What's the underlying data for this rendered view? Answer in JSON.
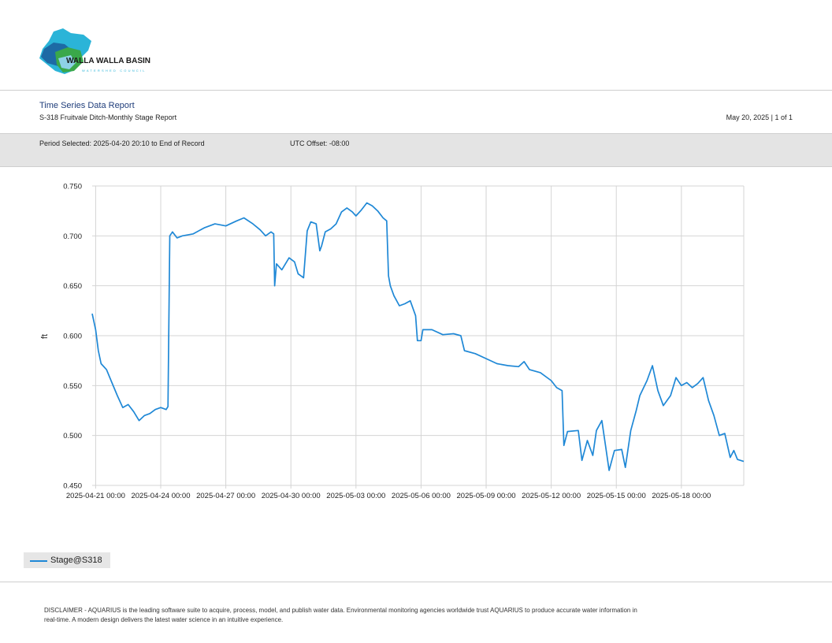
{
  "logo": {
    "title": "WALLA WALLA BASIN",
    "subtitle": "WATERSHED COUNCIL"
  },
  "header": {
    "title": "Time Series Data Report",
    "subtitle": "S-318 Fruitvale Ditch-Monthly Stage Report",
    "date_page": "May 20, 2025 | 1 of 1"
  },
  "period": {
    "selected": "Period Selected: 2025-04-20 20:10 to End of Record",
    "utc": "UTC Offset: -08:00"
  },
  "chart_data": {
    "type": "line",
    "ylabel": "ft",
    "ylim": [
      0.45,
      0.75
    ],
    "yticks": [
      "0.450",
      "0.500",
      "0.550",
      "0.600",
      "0.650",
      "0.700",
      "0.750"
    ],
    "xlim": [
      "2025-04-20 20:10",
      "2025-05-20 21:00"
    ],
    "xticks": [
      "2025-04-21 00:00",
      "2025-04-24 00:00",
      "2025-04-27 00:00",
      "2025-04-30 00:00",
      "2025-05-03 00:00",
      "2025-05-06 00:00",
      "2025-05-09 00:00",
      "2025-05-12 00:00",
      "2025-05-15 00:00",
      "2025-05-18 00:00"
    ],
    "grid": true,
    "legend_position": "bottom-left",
    "series": [
      {
        "name": "Stage@S318",
        "color": "#1f88d6",
        "points": [
          [
            "2025-04-20 20:10",
            0.622
          ],
          [
            "2025-04-21 00:00",
            0.606
          ],
          [
            "2025-04-21 03:00",
            0.585
          ],
          [
            "2025-04-21 06:00",
            0.572
          ],
          [
            "2025-04-21 12:00",
            0.566
          ],
          [
            "2025-04-21 18:00",
            0.553
          ],
          [
            "2025-04-22 00:00",
            0.54
          ],
          [
            "2025-04-22 06:00",
            0.528
          ],
          [
            "2025-04-22 12:00",
            0.531
          ],
          [
            "2025-04-22 18:00",
            0.524
          ],
          [
            "2025-04-23 00:00",
            0.515
          ],
          [
            "2025-04-23 06:00",
            0.52
          ],
          [
            "2025-04-23 12:00",
            0.522
          ],
          [
            "2025-04-23 18:00",
            0.526
          ],
          [
            "2025-04-24 00:00",
            0.528
          ],
          [
            "2025-04-24 06:00",
            0.526
          ],
          [
            "2025-04-24 08:00",
            0.529
          ],
          [
            "2025-04-24 10:00",
            0.7
          ],
          [
            "2025-04-24 13:00",
            0.704
          ],
          [
            "2025-04-24 18:00",
            0.698
          ],
          [
            "2025-04-25 00:00",
            0.7
          ],
          [
            "2025-04-25 12:00",
            0.702
          ],
          [
            "2025-04-26 00:00",
            0.708
          ],
          [
            "2025-04-26 12:00",
            0.712
          ],
          [
            "2025-04-27 00:00",
            0.71
          ],
          [
            "2025-04-27 12:00",
            0.715
          ],
          [
            "2025-04-27 20:00",
            0.718
          ],
          [
            "2025-04-28 06:00",
            0.712
          ],
          [
            "2025-04-28 14:00",
            0.706
          ],
          [
            "2025-04-28 20:00",
            0.7
          ],
          [
            "2025-04-29 02:00",
            0.704
          ],
          [
            "2025-04-29 05:00",
            0.702
          ],
          [
            "2025-04-29 06:00",
            0.65
          ],
          [
            "2025-04-29 08:00",
            0.672
          ],
          [
            "2025-04-29 14:00",
            0.666
          ],
          [
            "2025-04-29 18:00",
            0.672
          ],
          [
            "2025-04-29 22:00",
            0.678
          ],
          [
            "2025-04-30 04:00",
            0.674
          ],
          [
            "2025-04-30 08:00",
            0.662
          ],
          [
            "2025-04-30 14:00",
            0.658
          ],
          [
            "2025-04-30 18:00",
            0.705
          ],
          [
            "2025-04-30 22:00",
            0.714
          ],
          [
            "2025-05-01 04:00",
            0.712
          ],
          [
            "2025-05-01 08:00",
            0.685
          ],
          [
            "2025-05-01 10:00",
            0.69
          ],
          [
            "2025-05-01 14:00",
            0.704
          ],
          [
            "2025-05-01 20:00",
            0.707
          ],
          [
            "2025-05-02 02:00",
            0.712
          ],
          [
            "2025-05-02 08:00",
            0.724
          ],
          [
            "2025-05-02 14:00",
            0.728
          ],
          [
            "2025-05-02 20:00",
            0.724
          ],
          [
            "2025-05-03 00:00",
            0.72
          ],
          [
            "2025-05-03 06:00",
            0.726
          ],
          [
            "2025-05-03 12:00",
            0.733
          ],
          [
            "2025-05-03 18:00",
            0.73
          ],
          [
            "2025-05-04 00:00",
            0.725
          ],
          [
            "2025-05-04 06:00",
            0.718
          ],
          [
            "2025-05-04 10:00",
            0.715
          ],
          [
            "2025-05-04 12:00",
            0.66
          ],
          [
            "2025-05-04 14:00",
            0.65
          ],
          [
            "2025-05-04 18:00",
            0.64
          ],
          [
            "2025-05-05 00:00",
            0.63
          ],
          [
            "2025-05-05 06:00",
            0.632
          ],
          [
            "2025-05-05 12:00",
            0.635
          ],
          [
            "2025-05-05 18:00",
            0.62
          ],
          [
            "2025-05-05 20:00",
            0.595
          ],
          [
            "2025-05-06 00:00",
            0.595
          ],
          [
            "2025-05-06 02:00",
            0.606
          ],
          [
            "2025-05-06 12:00",
            0.606
          ],
          [
            "2025-05-07 00:00",
            0.601
          ],
          [
            "2025-05-07 12:00",
            0.602
          ],
          [
            "2025-05-07 20:00",
            0.6
          ],
          [
            "2025-05-08 00:00",
            0.585
          ],
          [
            "2025-05-08 12:00",
            0.582
          ],
          [
            "2025-05-09 00:00",
            0.577
          ],
          [
            "2025-05-09 12:00",
            0.572
          ],
          [
            "2025-05-10 00:00",
            0.57
          ],
          [
            "2025-05-10 12:00",
            0.569
          ],
          [
            "2025-05-10 18:00",
            0.574
          ],
          [
            "2025-05-11 00:00",
            0.566
          ],
          [
            "2025-05-11 12:00",
            0.563
          ],
          [
            "2025-05-12 00:00",
            0.555
          ],
          [
            "2025-05-12 06:00",
            0.548
          ],
          [
            "2025-05-12 12:00",
            0.545
          ],
          [
            "2025-05-12 14:00",
            0.49
          ],
          [
            "2025-05-12 18:00",
            0.504
          ],
          [
            "2025-05-13 06:00",
            0.505
          ],
          [
            "2025-05-13 10:00",
            0.475
          ],
          [
            "2025-05-13 16:00",
            0.495
          ],
          [
            "2025-05-13 22:00",
            0.48
          ],
          [
            "2025-05-14 02:00",
            0.505
          ],
          [
            "2025-05-14 08:00",
            0.515
          ],
          [
            "2025-05-14 12:00",
            0.49
          ],
          [
            "2025-05-14 16:00",
            0.465
          ],
          [
            "2025-05-14 22:00",
            0.485
          ],
          [
            "2025-05-15 06:00",
            0.486
          ],
          [
            "2025-05-15 10:00",
            0.468
          ],
          [
            "2025-05-15 16:00",
            0.505
          ],
          [
            "2025-05-15 22:00",
            0.525
          ],
          [
            "2025-05-16 02:00",
            0.54
          ],
          [
            "2025-05-16 10:00",
            0.555
          ],
          [
            "2025-05-16 16:00",
            0.57
          ],
          [
            "2025-05-16 22:00",
            0.545
          ],
          [
            "2025-05-17 04:00",
            0.53
          ],
          [
            "2025-05-17 12:00",
            0.54
          ],
          [
            "2025-05-17 18:00",
            0.558
          ],
          [
            "2025-05-18 00:00",
            0.55
          ],
          [
            "2025-05-18 06:00",
            0.553
          ],
          [
            "2025-05-18 12:00",
            0.548
          ],
          [
            "2025-05-18 18:00",
            0.552
          ],
          [
            "2025-05-19 00:00",
            0.558
          ],
          [
            "2025-05-19 06:00",
            0.535
          ],
          [
            "2025-05-19 12:00",
            0.52
          ],
          [
            "2025-05-19 18:00",
            0.5
          ],
          [
            "2025-05-20 00:00",
            0.502
          ],
          [
            "2025-05-20 06:00",
            0.478
          ],
          [
            "2025-05-20 10:00",
            0.485
          ],
          [
            "2025-05-20 14:00",
            0.476
          ],
          [
            "2025-05-20 21:00",
            0.474
          ]
        ]
      }
    ]
  },
  "legend": {
    "label": "Stage@S318"
  },
  "disclaimer": "DISCLAIMER - AQUARIUS is the leading software suite to acquire, process, model, and publish water data. Environmental monitoring agencies worldwide trust AQUARIUS to produce accurate water information in real-time. A modern design delivers the latest water science in an intuitive experience."
}
